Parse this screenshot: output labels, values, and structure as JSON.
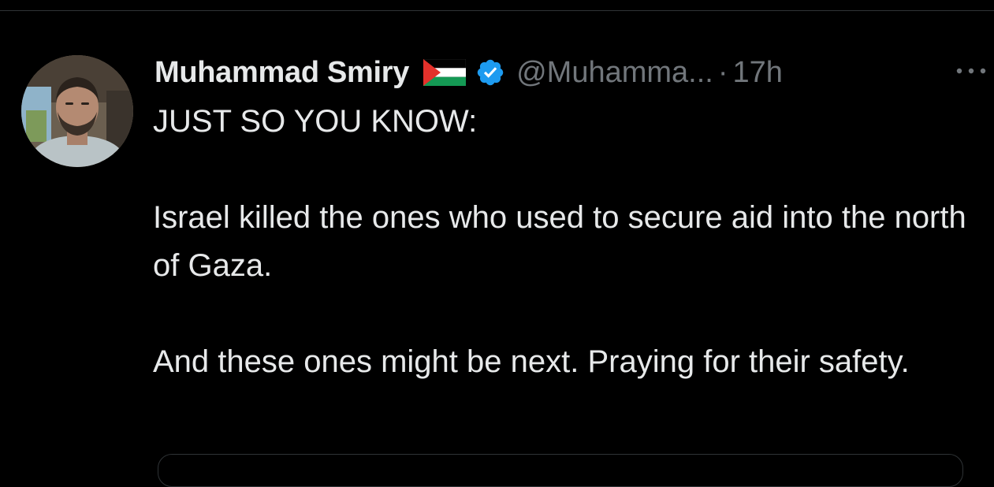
{
  "colors": {
    "background": "#000000",
    "text_primary": "#e7e9ea",
    "text_secondary": "#71767b",
    "verified_badge": "#1d9bf0",
    "divider": "#2f3336"
  },
  "tweet": {
    "author_name": "Muhammad Smiry",
    "author_flag": "palestine-flag-icon",
    "verified": true,
    "handle": "@Muhamma...",
    "separator": "·",
    "time": "17h",
    "more_icon": "more-icon",
    "paragraphs": [
      "JUST SO YOU KNOW:",
      "Israel killed the ones who used to secure aid into the north of Gaza.",
      "And these ones might be next. Praying for their safety."
    ]
  }
}
